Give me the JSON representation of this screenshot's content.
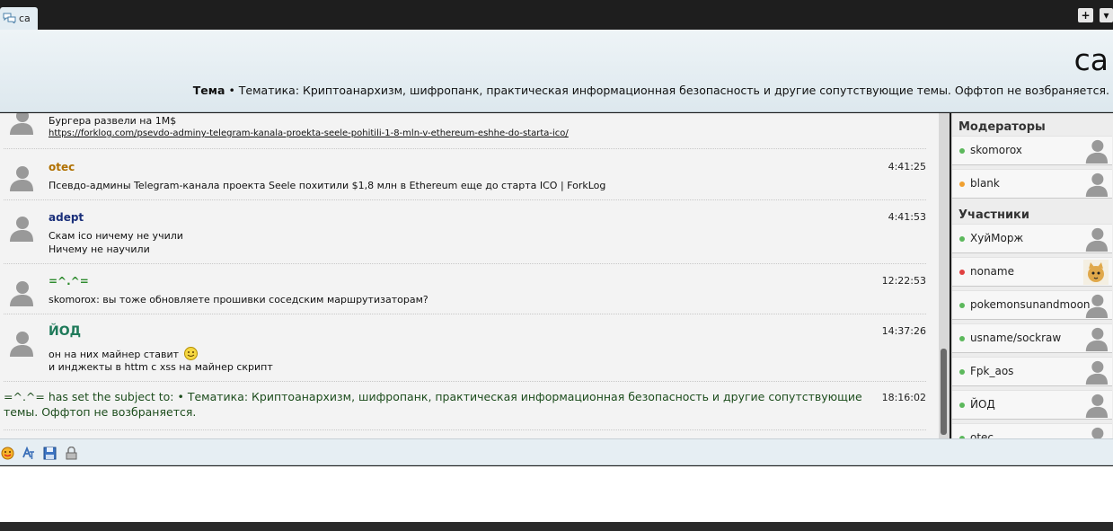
{
  "tab": {
    "label": "ca"
  },
  "window_buttons": {
    "add": "+",
    "menu": "▾"
  },
  "header": {
    "title": "ca",
    "topic_prefix": "Тема",
    "topic_text": "• Тематика: Криптоанархизм, шифропанк, практическая информационная безопасность и другие сопутствующие темы. Оффтоп не возбраняется."
  },
  "messages": [
    {
      "nick": "",
      "time": "",
      "lines": [
        "Бургера развели на 1М$"
      ],
      "link": "https://forklog.com/psevdo-adminy-telegram-kanala-proekta-seele-pohitili-1-8-mln-v-ethereum-eshhe-do-starta-ico/"
    },
    {
      "nick": "otec",
      "time": "4:41:25",
      "lines": [
        "Псевдо-админы Telegram-канала проекта Seele похитили $1,8 млн в Ethereum еще до старта ICO | ForkLog"
      ]
    },
    {
      "nick": "adept",
      "time": "4:41:53",
      "lines": [
        "Скам ico ничему не учили",
        "Ничему не научили"
      ]
    },
    {
      "nick": "=^.^=",
      "time": "12:22:53",
      "lines": [
        "skomorox: вы тоже обновляете прошивки соседским маршрутизаторам?"
      ]
    },
    {
      "nick": "ЙОД",
      "time": "14:37:26",
      "lines": [
        "он на них майнер ставит",
        "и инджекты в httm с xss на майнер скрипт"
      ]
    },
    {
      "system": "=^.^= has set the subject to: • Тематика: Криптоанархизм, шифропанк, практическая информационная безопасность и другие сопутствующие",
      "system2": "темы. Оффтоп не возбраняется.",
      "time": "18:16:02"
    }
  ],
  "roster": {
    "moderators_label": "Модераторы",
    "participants_label": "Участники",
    "moderators": [
      {
        "name": "skomorox",
        "status": "online"
      },
      {
        "name": "blank",
        "status": "away"
      }
    ],
    "participants": [
      {
        "name": "ХуйМорж",
        "status": "online"
      },
      {
        "name": "noname",
        "status": "busy"
      },
      {
        "name": "pokemonsunandmoon",
        "status": "online"
      },
      {
        "name": "usname/sockraw",
        "status": "online"
      },
      {
        "name": "Fpk_aos",
        "status": "online"
      },
      {
        "name": "ЙОД",
        "status": "online"
      },
      {
        "name": "otec",
        "status": "online"
      }
    ]
  },
  "colors": {
    "otec": "#b07000",
    "adept": "#1a2f7a",
    "cat": "#2e8b2e",
    "yod": "#1f7a5a",
    "online": "#5cb85c",
    "away": "#f0a030",
    "busy": "#e04040",
    "system": "#1d4d1d"
  },
  "toolbar": {
    "icons": [
      "smiley-icon",
      "translate-icon",
      "save-icon",
      "lock-icon"
    ]
  }
}
